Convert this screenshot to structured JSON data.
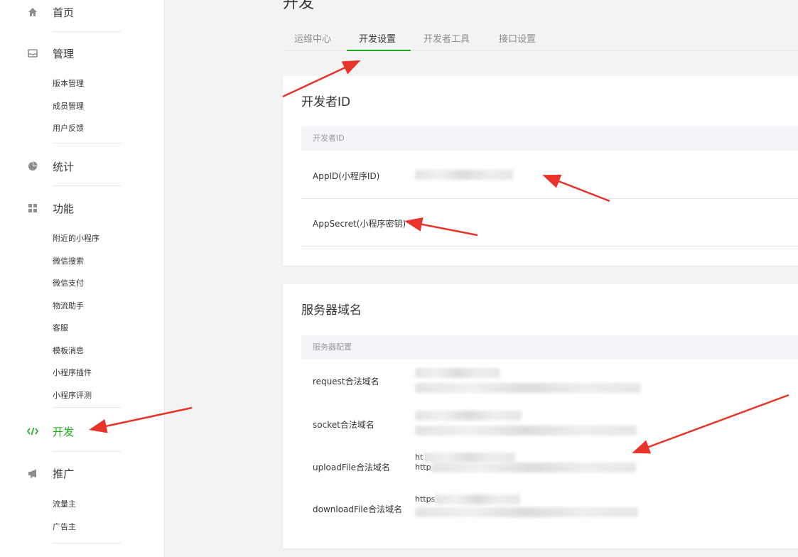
{
  "sidebar": {
    "home": "首页",
    "manage": "管理",
    "manage_items": [
      "版本管理",
      "成员管理",
      "用户反馈"
    ],
    "stats": "统计",
    "features": "功能",
    "feature_items": [
      "附近的小程序",
      "微信搜索",
      "微信支付",
      "物流助手",
      "客服",
      "模板消息",
      "小程序插件",
      "小程序评测"
    ],
    "dev": "开发",
    "promote": "推广",
    "promote_items": [
      "流量主",
      "广告主"
    ]
  },
  "page": {
    "title": "开发"
  },
  "tabs": [
    "运维中心",
    "开发设置",
    "开发者工具",
    "接口设置"
  ],
  "developer_id": {
    "title": "开发者ID",
    "table_head": "开发者ID",
    "appid_label": "AppID(小程序ID)",
    "appsecret_label": "AppSecret(小程序密钥)"
  },
  "server_domain": {
    "title": "服务器域名",
    "table_head": "服务器配置",
    "rows": [
      "request合法域名",
      "socket合法域名",
      "uploadFile合法域名",
      "downloadFile合法域名"
    ],
    "visible_prefixes": [
      "ht",
      "http",
      "https"
    ]
  },
  "colors": {
    "accent": "#1aad19",
    "annotation": "#e8322a"
  }
}
